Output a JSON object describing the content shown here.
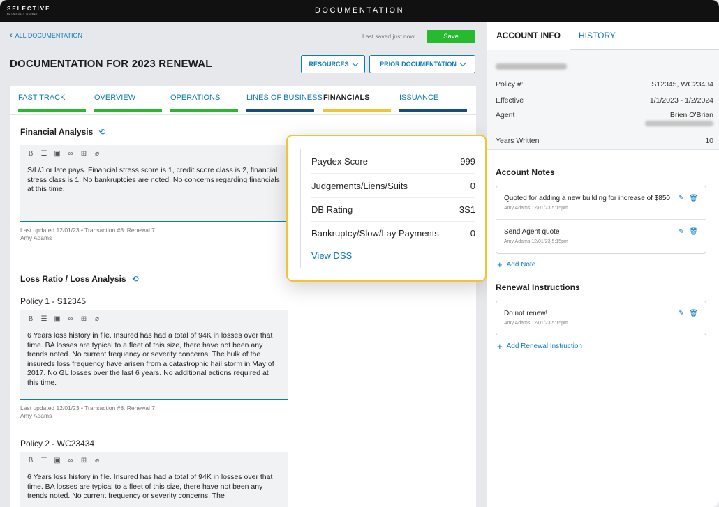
{
  "header": {
    "logo_main": "SELECTIVE",
    "logo_sub": "BE UNIQUELY INSURED",
    "title": "DOCUMENTATION"
  },
  "toolbar": {
    "back_label": "ALL DOCUMENTATION",
    "last_saved": "Last saved just now",
    "save_label": "Save"
  },
  "page": {
    "title": "DOCUMENTATION FOR 2023 RENEWAL",
    "resources_label": "RESOURCES",
    "prior_label": "PRIOR DOCUMENTATION"
  },
  "tabs": [
    {
      "label": "FAST TRACK",
      "color": "#27b92e"
    },
    {
      "label": "OVERVIEW",
      "color": "#27b92e"
    },
    {
      "label": "OPERATIONS",
      "color": "#27b92e"
    },
    {
      "label": "LINES OF BUSINESS",
      "color": "#1a4e7a"
    },
    {
      "label": "FINANCIALS",
      "color": "#f4c235"
    },
    {
      "label": "ISSUANCE",
      "color": "#1a4e7a"
    }
  ],
  "financial": {
    "title": "Financial Analysis",
    "text": "S/L/J or late pays. Financial stress score is 1, credit score class is 2, financial stress class is 1. No bankruptcies are noted. No concerns regarding financials at this time.",
    "meta_line1": "Last updated 12/01/23 • Transaction #8: Renewal 7",
    "meta_line2": "Amy Adams"
  },
  "loss": {
    "title": "Loss Ratio / Loss Analysis",
    "policy1": {
      "heading": "Policy 1 - S12345",
      "text": "6 Years loss history in file. Insured has had a total of 94K in losses over that time. BA losses are typical to a fleet of this size, there have not been any trends noted. No current frequency or severity concerns. The bulk of the insureds loss frequency have arisen from a catastrophic hail storm in May of 2017. No GL losses over the last 6 years. No additional actions required at this time.",
      "meta_line1": "Last updated 12/01/23 • Transaction #8: Renewal 7",
      "meta_line2": "Amy Adams"
    },
    "policy2": {
      "heading": "Policy 2 - WC23434",
      "text": "6 Years loss history in file. Insured has had a total of 94K in losses over that time. BA losses are typical to a fleet of this size, there have not been any trends noted. No current frequency or severity concerns. The"
    }
  },
  "popover": {
    "rows": [
      {
        "label": "Paydex Score",
        "value": "999"
      },
      {
        "label": "Judgements/Liens/Suits",
        "value": "0"
      },
      {
        "label": "DB Rating",
        "value": "3S1"
      },
      {
        "label": "Bankruptcy/Slow/Lay Payments",
        "value": "0"
      }
    ],
    "link": "View DSS"
  },
  "panel": {
    "tab_account": "ACCOUNT INFO",
    "tab_history": "HISTORY",
    "policy_label": "Policy #:",
    "policy_value": "S12345, WC23434",
    "effective_label": "Effective",
    "effective_value": "1/1/2023 - 1/2/2024",
    "agent_label": "Agent",
    "agent_value": "Brien O'Brian",
    "years_label": "Years Written",
    "years_value": "10",
    "notes_title": "Account Notes",
    "notes": [
      {
        "text": "Quoted for adding a new building for increase of $850",
        "meta": "Amy Adams 12/01/23 5:15pm"
      },
      {
        "text": "Send Agent quote",
        "meta": "Amy Adams 12/01/23 5:15pm"
      }
    ],
    "add_note": "Add Note",
    "renewal_title": "Renewal Instructions",
    "renewal": [
      {
        "text": "Do not renew!",
        "meta": "Amy Adams 12/01/23 5:15pm"
      }
    ],
    "add_renewal": "Add Renewal Instruction"
  }
}
